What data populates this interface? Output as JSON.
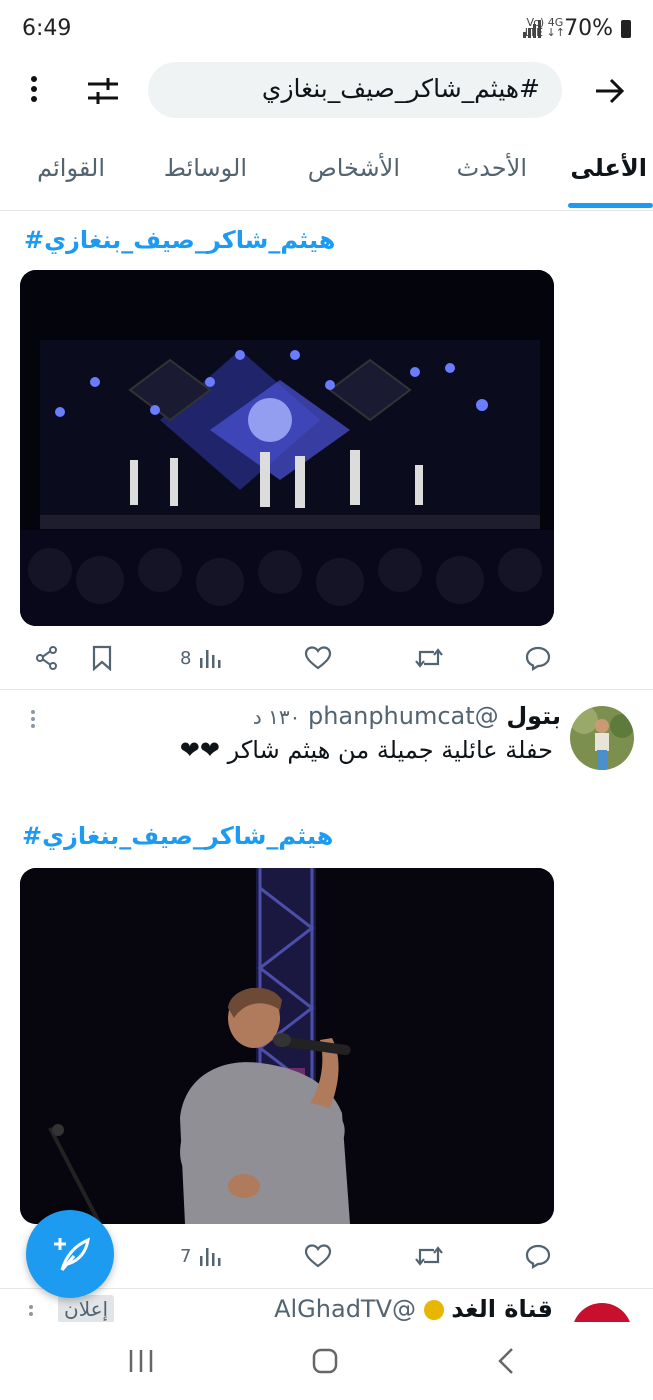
{
  "status_bar": {
    "time": "6:49",
    "network_top": "Vo) 4G",
    "network_bottom": "LTE ↓↑",
    "battery": "70%"
  },
  "search": {
    "query": "#هيثم_شاكر_صيف_بنغازي"
  },
  "tabs": [
    {
      "label": "الأعلى",
      "active": true
    },
    {
      "label": "الأحدث",
      "active": false
    },
    {
      "label": "الأشخاص",
      "active": false
    },
    {
      "label": "الوسائط",
      "active": false
    },
    {
      "label": "القوائم",
      "active": false
    }
  ],
  "tweet1": {
    "hashtag": "هيثم_شاكر_صيف_بنغازي#",
    "views": "8"
  },
  "tweet2": {
    "name": "بتول",
    "handle": "@phanphumcat",
    "time": "١٣٠ د",
    "text": "حفلة عائلية جميلة من هيثم شاكر ❤❤",
    "hashtag": "هيثم_شاكر_صيف_بنغازي#",
    "views": "7"
  },
  "tweet3": {
    "name": "قناة الغد",
    "handle": "@AlGhadTV",
    "ad_label": "إعلان"
  },
  "colors": {
    "accent": "#1d9bf0",
    "text_secondary": "#536471",
    "heart": "#f0284a"
  }
}
